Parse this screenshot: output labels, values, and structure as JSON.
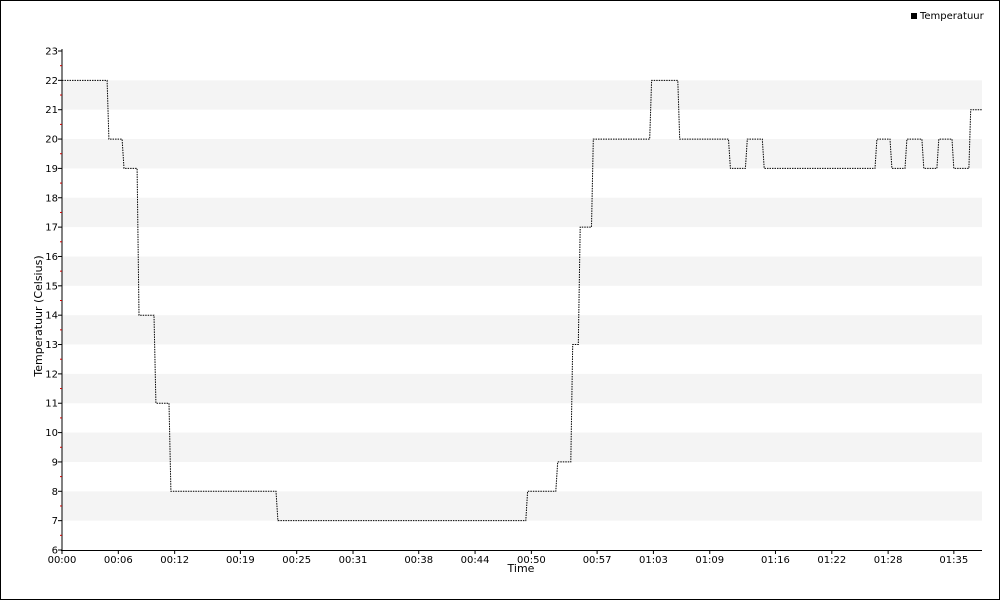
{
  "chart_data": {
    "type": "line",
    "title": "",
    "xlabel": "Time",
    "ylabel": "Temperatuur (Celsius)",
    "x_unit": "minutes",
    "xlim": [
      0,
      98
    ],
    "ylim": [
      6,
      23
    ],
    "y_ticks": [
      6,
      7,
      8,
      9,
      10,
      11,
      12,
      13,
      14,
      15,
      16,
      17,
      18,
      19,
      20,
      21,
      22,
      23
    ],
    "x_tick_minutes": [
      0,
      6,
      12,
      19,
      25,
      31,
      38,
      44,
      50,
      57,
      63,
      69,
      76,
      82,
      88,
      95
    ],
    "x_tick_labels": [
      "00:00",
      "00:06",
      "00:12",
      "00:19",
      "00:25",
      "00:31",
      "00:38",
      "00:44",
      "00:50",
      "00:57",
      "01:03",
      "01:09",
      "01:16",
      "01:22",
      "01:28",
      "01:35"
    ],
    "grid": "alternating horizontal bands",
    "band_color": "#f4f4f4",
    "line_color": "#000000",
    "legend": {
      "position": "top-right",
      "marker_color": "#000000"
    },
    "series": [
      {
        "name": "Temperatuur",
        "x": [
          0,
          4.8,
          5.0,
          6.4,
          6.6,
          8.0,
          8.2,
          9.8,
          10.0,
          11.4,
          11.6,
          22.8,
          23.0,
          49.4,
          49.6,
          52.6,
          52.8,
          54.2,
          54.4,
          55.0,
          55.2,
          56.4,
          56.6,
          57.6,
          57.8,
          62.6,
          62.8,
          65.6,
          65.8,
          71.0,
          71.2,
          72.8,
          73.0,
          74.6,
          74.8,
          86.6,
          86.8,
          88.2,
          88.4,
          89.8,
          90.0,
          91.6,
          91.8,
          93.2,
          93.4,
          94.8,
          95.0,
          96.6,
          96.8,
          98.0
        ],
        "y": [
          22,
          22,
          20,
          20,
          19,
          19,
          14,
          14,
          11,
          11,
          8,
          8,
          7,
          7,
          8,
          8,
          9,
          9,
          13,
          13,
          17,
          17,
          20,
          20,
          20,
          20,
          22,
          22,
          20,
          20,
          19,
          19,
          20,
          20,
          19,
          19,
          20,
          20,
          19,
          19,
          20,
          20,
          19,
          19,
          20,
          20,
          19,
          19,
          21,
          21
        ]
      }
    ]
  }
}
